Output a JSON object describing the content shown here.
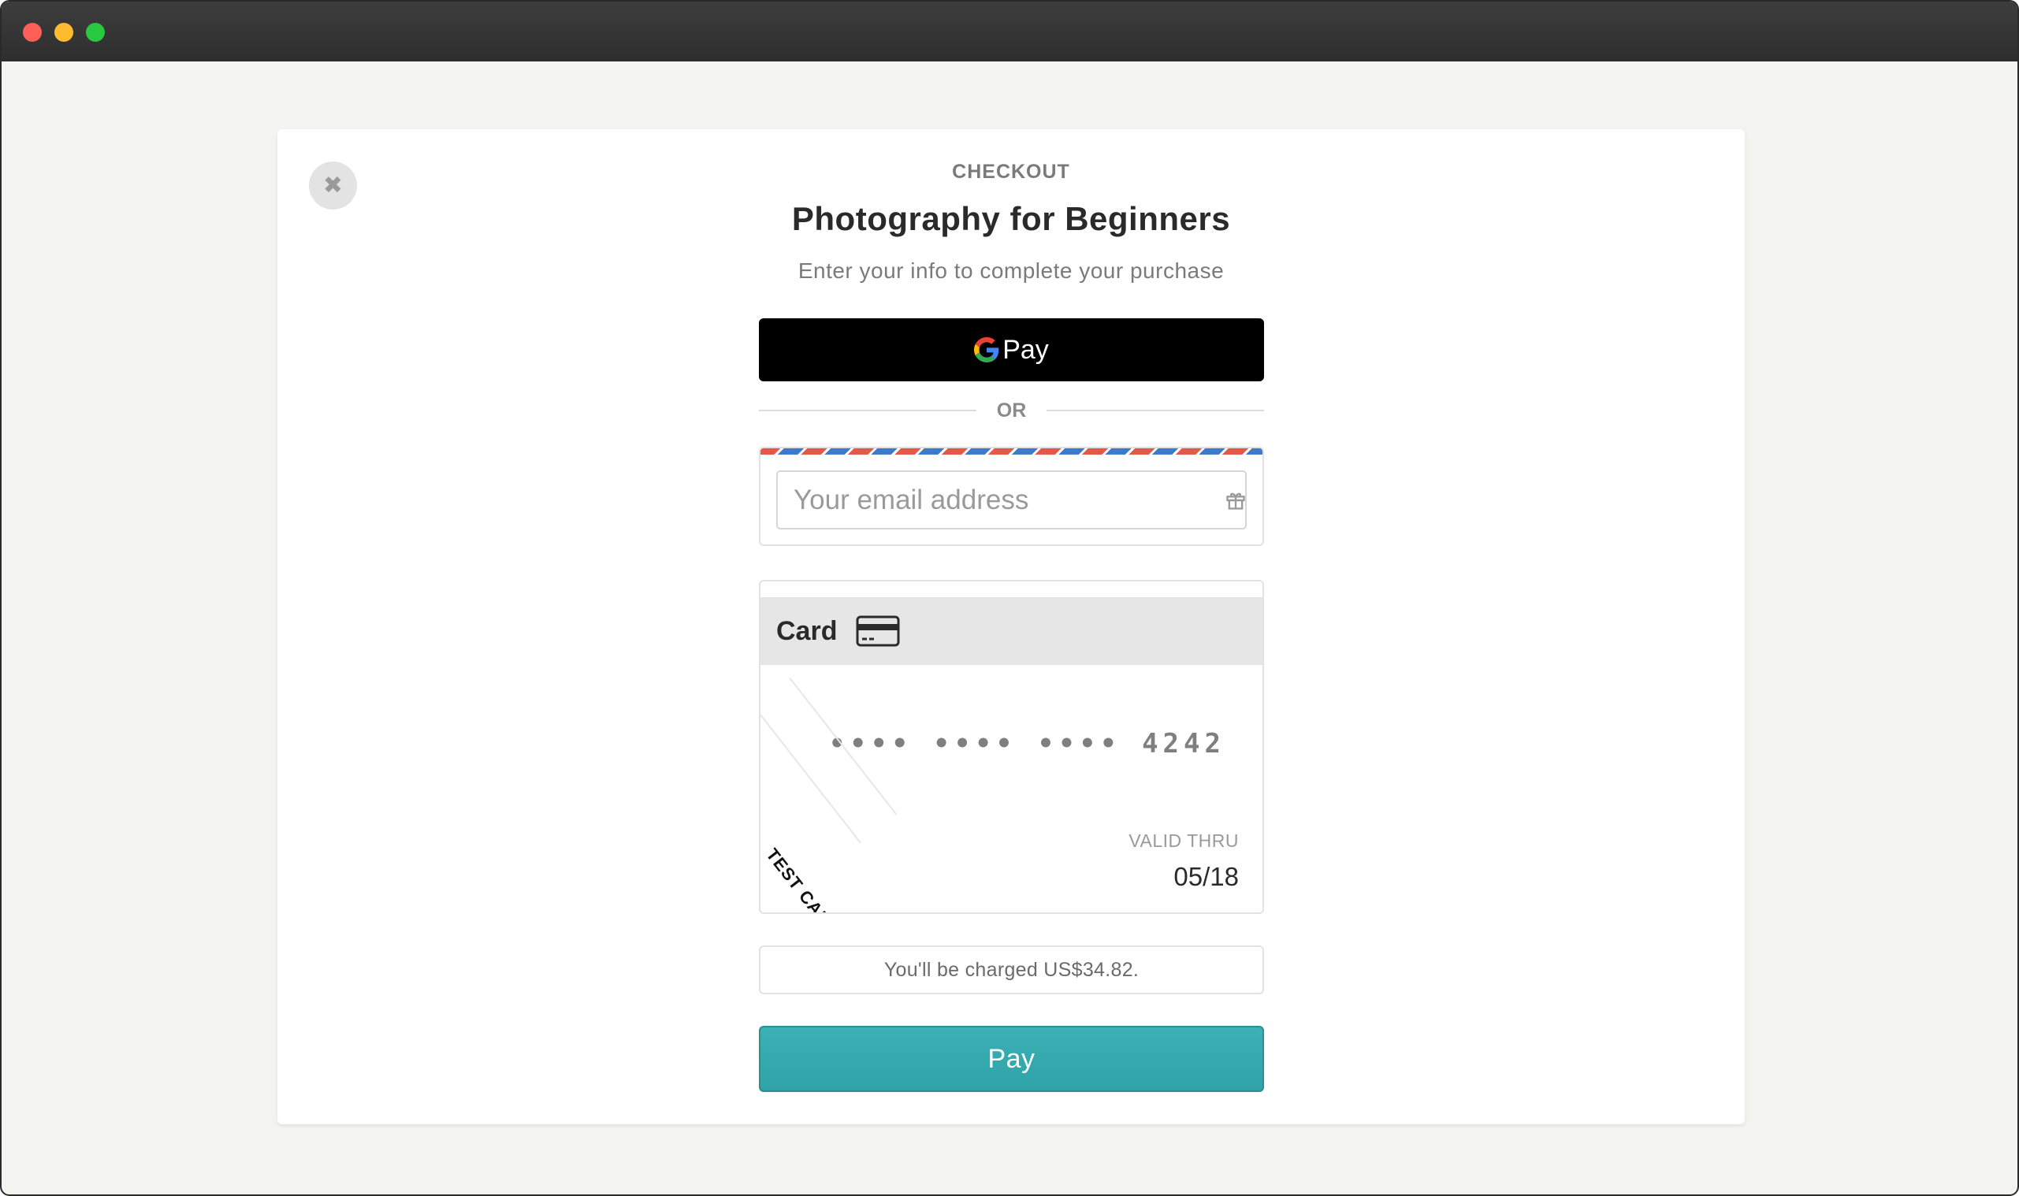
{
  "window": {
    "controls": [
      "close",
      "minimize",
      "zoom"
    ]
  },
  "checkout": {
    "eyebrow": "CHECKOUT",
    "title": "Photography for Beginners",
    "subtitle": "Enter your info to complete your purchase",
    "close_icon": "close-icon"
  },
  "gpay": {
    "label": "Pay",
    "icon": "google-g-icon"
  },
  "divider": {
    "label": "OR"
  },
  "email": {
    "placeholder": "Your email address",
    "value": "",
    "icon": "gift-icon"
  },
  "card": {
    "header_label": "Card",
    "icon": "credit-card-icon",
    "number": "•••• •••• •••• 4242",
    "badge": "TEST CARD",
    "valid_thru_label": "VALID THRU",
    "valid_thru_value": "05/18"
  },
  "charge": {
    "text": "You'll be charged US$34.82."
  },
  "pay_button": {
    "label": "Pay"
  },
  "colors": {
    "accent": "#35a9ad",
    "airmail_red": "#e4574b",
    "airmail_blue": "#3f7ac9",
    "gpay_bg": "#000000"
  }
}
